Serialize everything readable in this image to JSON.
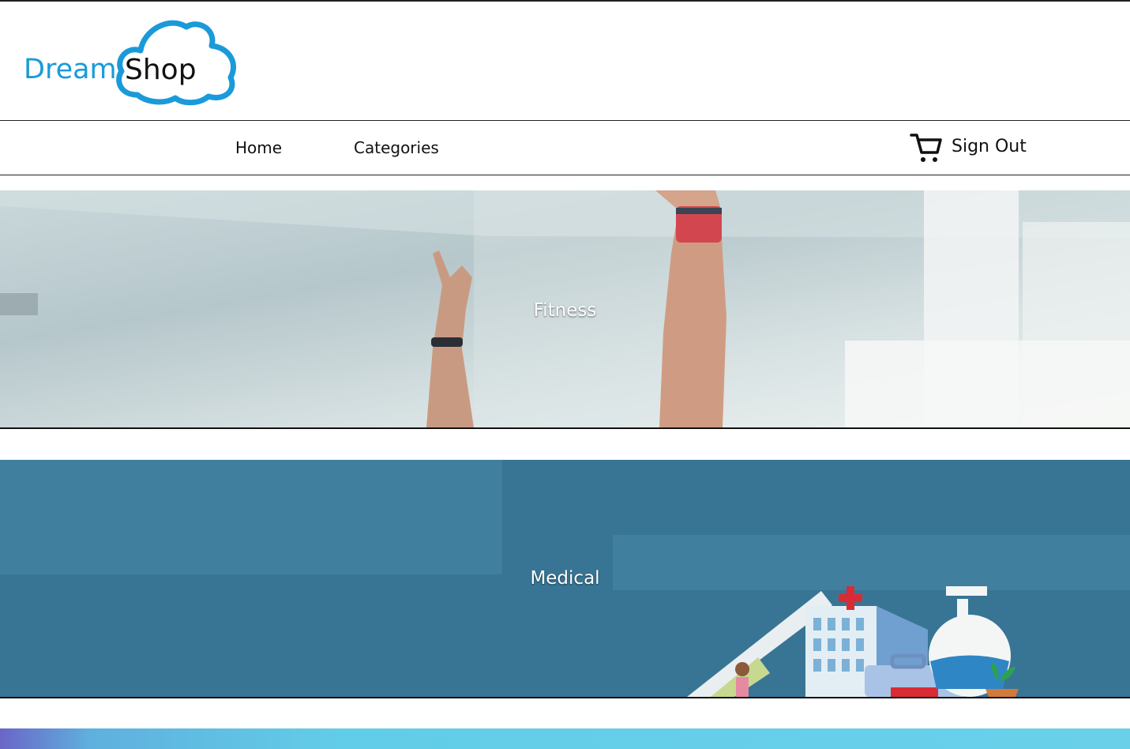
{
  "brand": {
    "word1": "Dream",
    "word2": "Shop",
    "accent_color": "#1a9ad9"
  },
  "nav": {
    "items": [
      {
        "label": "Home"
      },
      {
        "label": "Categories"
      }
    ],
    "cart_icon": "shopping-cart-icon",
    "signout_label": "Sign Out"
  },
  "categories": [
    {
      "label": "Fitness",
      "bg_color": "#c9d8db"
    },
    {
      "label": "Medical",
      "bg_color": "#387595"
    }
  ],
  "next_banner_color": "#62cde8"
}
